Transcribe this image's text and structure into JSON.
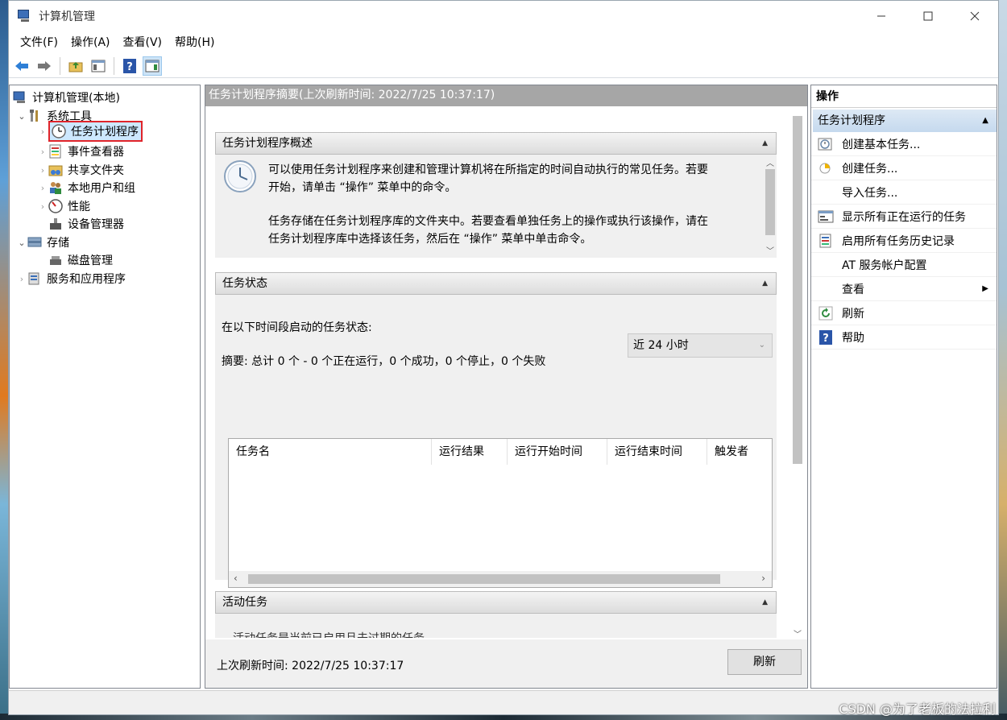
{
  "window": {
    "title": "计算机管理"
  },
  "menu": [
    {
      "label": "文件(F)",
      "name": "menu-file"
    },
    {
      "label": "操作(A)",
      "name": "menu-action"
    },
    {
      "label": "查看(V)",
      "name": "menu-view"
    },
    {
      "label": "帮助(H)",
      "name": "menu-help"
    }
  ],
  "tree": {
    "root": "计算机管理(本地)",
    "system_tools": "系统工具",
    "task_scheduler": "任务计划程序",
    "event_viewer": "事件查看器",
    "shared_folders": "共享文件夹",
    "local_users": "本地用户和组",
    "performance": "性能",
    "device_manager": "设备管理器",
    "storage": "存储",
    "disk_management": "磁盘管理",
    "services_apps": "服务和应用程序"
  },
  "center": {
    "header": "任务计划程序摘要(上次刷新时间: 2022/7/25 10:37:17)",
    "overview_title": "任务计划程序概述",
    "overview_p1a": "可以使用任务计划程序来创建和管理计算机将在所指定的时间自动执行的常见任务。若要",
    "overview_p1b": "开始，请单击 “操作” 菜单中的命令。",
    "overview_p2a": "任务存储在任务计划程序库的文件夹中。若要查看单独任务上的操作或执行该操作，请在",
    "overview_p2b": "任务计划程序库中选择该任务，然后在 “操作” 菜单中单击命令。",
    "status_title": "任务状态",
    "status_label": "在以下时间段启动的任务状态:",
    "status_period": "近 24 小时",
    "summary": "摘要: 总计 0 个 - 0 个正在运行，0 个成功，0 个停止，0 个失败",
    "columns": [
      "任务名",
      "运行结果",
      "运行开始时间",
      "运行结束时间",
      "触发者"
    ],
    "active_title": "活动任务",
    "active_text": "活动任务是当前已启用且未过期的任务。",
    "last_refresh": "上次刷新时间: 2022/7/25 10:37:17",
    "refresh_button": "刷新"
  },
  "actions": {
    "title": "操作",
    "group": "任务计划程序",
    "items": [
      {
        "label": "创建基本任务...",
        "icon": "create-basic-task-icon"
      },
      {
        "label": "创建任务...",
        "icon": "create-task-icon"
      },
      {
        "label": "导入任务...",
        "icon": ""
      },
      {
        "label": "显示所有正在运行的任务",
        "icon": "running-tasks-icon"
      },
      {
        "label": "启用所有任务历史记录",
        "icon": "history-icon"
      },
      {
        "label": "AT 服务帐户配置",
        "icon": ""
      },
      {
        "label": "查看",
        "icon": ""
      },
      {
        "label": "刷新",
        "icon": "refresh-icon"
      },
      {
        "label": "帮助",
        "icon": "help-icon"
      }
    ]
  },
  "watermark": "CSDN @为了老板的法拉利"
}
